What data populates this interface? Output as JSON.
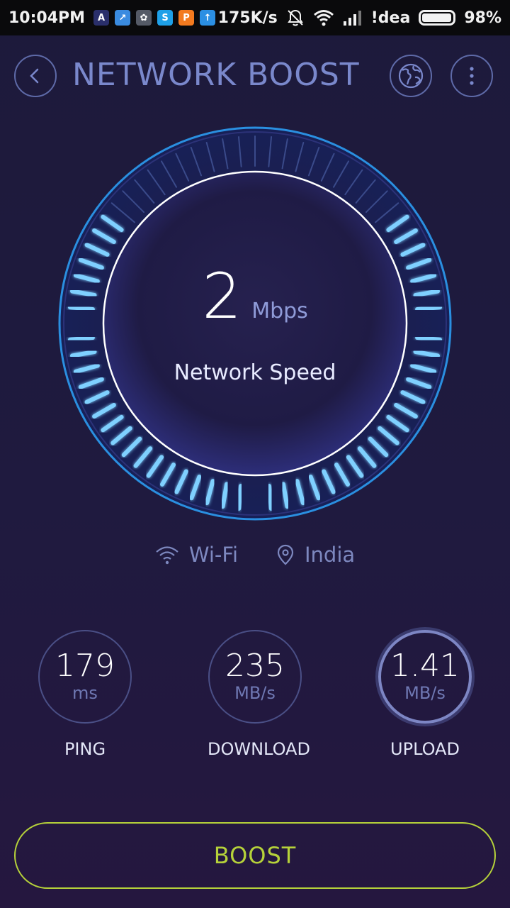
{
  "status_bar": {
    "time": "10:04PM",
    "speed": "175K/s",
    "carrier": "!dea",
    "battery_percent": "98%",
    "battery_level": 0.98,
    "app_icons": [
      {
        "name": "a-app-icon",
        "color": "#2a2f6b",
        "glyph": "A"
      },
      {
        "name": "chart-app-icon",
        "color": "#3a8be0",
        "glyph": "↗"
      },
      {
        "name": "gallery-app-icon",
        "color": "#555a66",
        "glyph": "✿"
      },
      {
        "name": "skype-app-icon",
        "color": "#1ea0e8",
        "glyph": "S"
      },
      {
        "name": "orange-app-icon",
        "color": "#f37a1f",
        "glyph": "P"
      },
      {
        "name": "upload-app-icon",
        "color": "#2b8fe3",
        "glyph": "↑"
      }
    ]
  },
  "header": {
    "title": "NETWORK BOOST"
  },
  "gauge": {
    "speed_value": "2",
    "speed_unit": "Mbps",
    "label": "Network Speed",
    "level": 0.82
  },
  "network": {
    "connection": "Wi-Fi",
    "location": "India"
  },
  "stats": {
    "ping": {
      "value": "179",
      "unit": "ms",
      "label": "PING"
    },
    "download": {
      "value": "235",
      "unit": "MB/s",
      "label": "DOWNLOAD"
    },
    "upload": {
      "value": "1.41",
      "unit": "MB/s",
      "label": "UPLOAD"
    }
  },
  "boost_button": {
    "label": "BOOST"
  },
  "colors": {
    "accent": "#b6d23a",
    "title": "#7a88cc",
    "tick_active": "#7fd0ff",
    "tick_inactive": "#3a4a8a",
    "ring_outer": "#2a8fe0"
  }
}
